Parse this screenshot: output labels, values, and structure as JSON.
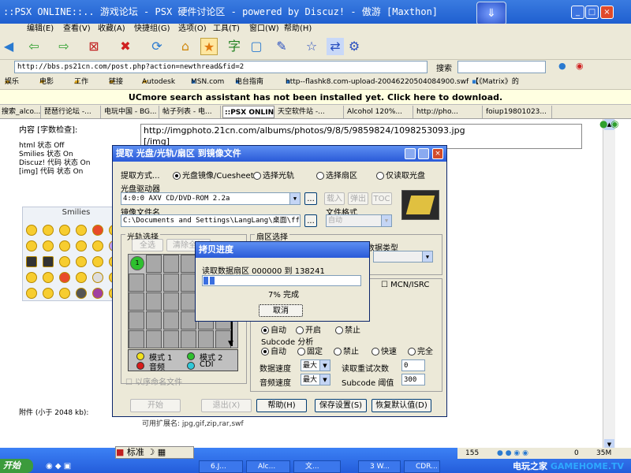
{
  "browser": {
    "title": "::PSX ONLINE::.. 游戏论坛 - PSX 硬件讨论区 - powered by Discuz! - 傲游 [Maxthon]",
    "menu": [
      "编辑(E)",
      "查看(V)",
      "收藏(A)",
      "快捷组(G)",
      "选项(O)",
      "工具(T)",
      "窗口(W)",
      "帮助(H)"
    ],
    "address": "http://bbs.ps21cn.com/post.php?action=newthread&fid=2",
    "search_label": "搜索",
    "favorites": [
      "娱乐",
      "电影",
      "工作",
      "链接",
      "Autodesk",
      "MSN.com",
      "电台指南",
      "http--flashk8.com-upload-20046220504084900.swf",
      "【《Matrix》的"
    ],
    "uc_notice": "UCmore search assistant has not been installed yet. Click here to download.",
    "tabs": [
      "搜索_alco...",
      "琵琶行论坛 -...",
      "电玩中国 - BG...",
      "帖子列表 - 电...",
      "::PSX ONLIN...",
      "天空软件站 -...",
      "Alcohol 120%...",
      "http://pho...",
      "foiup19801023..."
    ]
  },
  "page": {
    "content_check": "内容 [字数检查]:",
    "html_status": "html 状态 Off",
    "smilies_status": "Smilies 状态 On",
    "discuz_status": "Discuz! 代码 状态 On",
    "img_status": "[img] 代码 状态 On",
    "smilies_title": "Smilies",
    "textarea_line1": "http://imgphoto.21cn.com/albums/photos/9/8/5/9859824/1098253093.jpg",
    "textarea_line2": "[/img]",
    "attach_label": "附件 (小于 2048 kb):",
    "ext_label": "可用扩展名: jpg,gif,zip,rar,swf"
  },
  "dialog": {
    "title": "提取 光盘/光轨/扇区 到镜像文件",
    "method_label": "提取方式...",
    "methods": [
      "光盘镜像/Cuesheet",
      "选择光轨",
      "选择扇区",
      "仅读取光盘"
    ],
    "drive_label": "光盘驱动器",
    "drive_value": "4:0:0 AXV        CD/DVD-ROM       2.2a",
    "btn_load": "载入",
    "btn_eject": "弹出",
    "btn_toc": "TOC",
    "image_file_label": "镜像文件名",
    "image_file_value": "C:\\Documents and Settings\\LangLang\\桌面\\ff6",
    "file_format_label": "文件格式",
    "file_format_value": "自动",
    "track_select_label": "光轨选择",
    "btn_select_all": "全选",
    "btn_clear_all": "清除全部",
    "sector_select_label": "扇区选择",
    "data_type_label": "数据类型",
    "track_number": "1",
    "legend": [
      {
        "label": "模式 1",
        "color": "#f2e11a"
      },
      {
        "label": "模式 2",
        "color": "#2ec02e"
      },
      {
        "label": "音频",
        "color": "#d81a1a"
      },
      {
        "label": "CDI",
        "color": "#2ec8d8"
      }
    ],
    "seq_name_label": "以序命名文件",
    "mcn_label": "MCN/ISRC",
    "read_mode_options": [
      "自动",
      "开启",
      "禁止"
    ],
    "subcode_label": "Subcode 分析",
    "subcode_options": [
      "自动",
      "固定",
      "禁止",
      "快速",
      "完全"
    ],
    "data_speed_label": "数据速度",
    "data_speed_value": "最大",
    "retry_label": "读取重试次数",
    "retry_value": "0",
    "audio_speed_label": "音频速度",
    "audio_speed_value": "最大",
    "subcode_threshold_label": "Subcode 阈值",
    "subcode_threshold_value": "300",
    "btn_start": "开始",
    "btn_exit": "退出(X)",
    "btn_help": "帮助(H)",
    "btn_save": "保存设置(S)",
    "btn_restore": "恢复默认值(D)"
  },
  "progress": {
    "title": "拷贝进度",
    "status": "读取数据扇区 000000 到 138241",
    "percent": 7,
    "percent_text": "7% 完成",
    "cancel": "取消"
  },
  "taskbar": {
    "start": "开始",
    "ime": "标准",
    "items": [
      "6.J...",
      "Alc...",
      "文...",
      "3 W...",
      "CDR..."
    ],
    "status": [
      "155",
      "0",
      "35M"
    ]
  },
  "watermark": {
    "cn": "电玩之家",
    "en": "GAMEHOME.TV"
  }
}
